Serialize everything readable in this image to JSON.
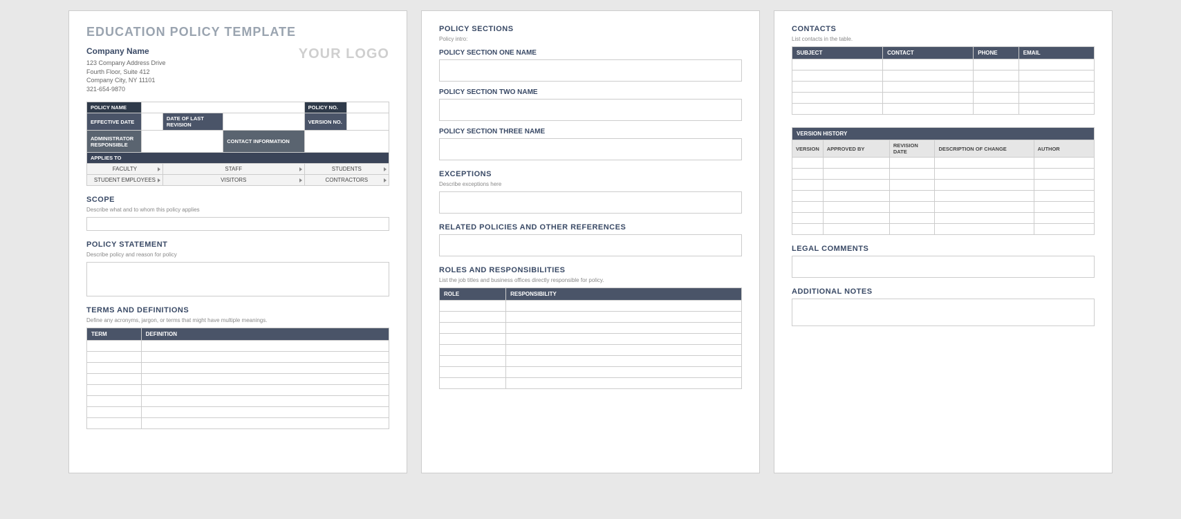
{
  "doc_title": "EDUCATION POLICY TEMPLATE",
  "company": {
    "name": "Company Name",
    "addr1": "123 Company Address Drive",
    "addr2": "Fourth Floor, Suite 412",
    "addr3": "Company City, NY  11101",
    "phone": "321-654-9870"
  },
  "logo_text": "YOUR LOGO",
  "info_labels": {
    "policy_name": "POLICY NAME",
    "policy_no": "POLICY NO.",
    "effective_date": "EFFECTIVE DATE",
    "date_last_rev": "DATE OF LAST REVISION",
    "version_no": "VERSION NO.",
    "admin_resp": "ADMINISTRATOR RESPONSIBLE",
    "contact_info": "CONTACT INFORMATION",
    "applies_to": "APPLIES TO"
  },
  "applies": {
    "faculty": "FACULTY",
    "staff": "STAFF",
    "students": "STUDENTS",
    "student_emp": "STUDENT EMPLOYEES",
    "visitors": "VISITORS",
    "contractors": "CONTRACTORS"
  },
  "scope": {
    "title": "SCOPE",
    "desc": "Describe what and to whom this policy applies"
  },
  "policy_statement": {
    "title": "POLICY STATEMENT",
    "desc": "Describe policy and reason for policy"
  },
  "terms": {
    "title": "TERMS AND DEFINITIONS",
    "desc": "Define any acronyms, jargon, or terms that might have multiple meanings.",
    "col1": "TERM",
    "col2": "DEFINITION"
  },
  "p2": {
    "sections_title": "POLICY SECTIONS",
    "sections_desc": "Policy intro:",
    "sec1": "POLICY SECTION ONE NAME",
    "sec2": "POLICY SECTION TWO NAME",
    "sec3": "POLICY SECTION THREE NAME",
    "exceptions_title": "EXCEPTIONS",
    "exceptions_desc": "Describe exceptions here",
    "related_title": "RELATED POLICIES AND OTHER REFERENCES",
    "roles_title": "ROLES AND RESPONSIBILITIES",
    "roles_desc": "List the job titles and business offices directly responsible for policy.",
    "role_col": "ROLE",
    "resp_col": "RESPONSIBILITY"
  },
  "p3": {
    "contacts_title": "CONTACTS",
    "contacts_desc": "List contacts in the table.",
    "c_subject": "SUBJECT",
    "c_contact": "CONTACT",
    "c_phone": "PHONE",
    "c_email": "EMAIL",
    "vh_title": "VERSION HISTORY",
    "vh_version": "VERSION",
    "vh_approved": "APPROVED BY",
    "vh_revdate": "REVISION DATE",
    "vh_desc": "DESCRIPTION OF CHANGE",
    "vh_author": "AUTHOR",
    "legal_title": "LEGAL COMMENTS",
    "notes_title": "ADDITIONAL NOTES"
  }
}
